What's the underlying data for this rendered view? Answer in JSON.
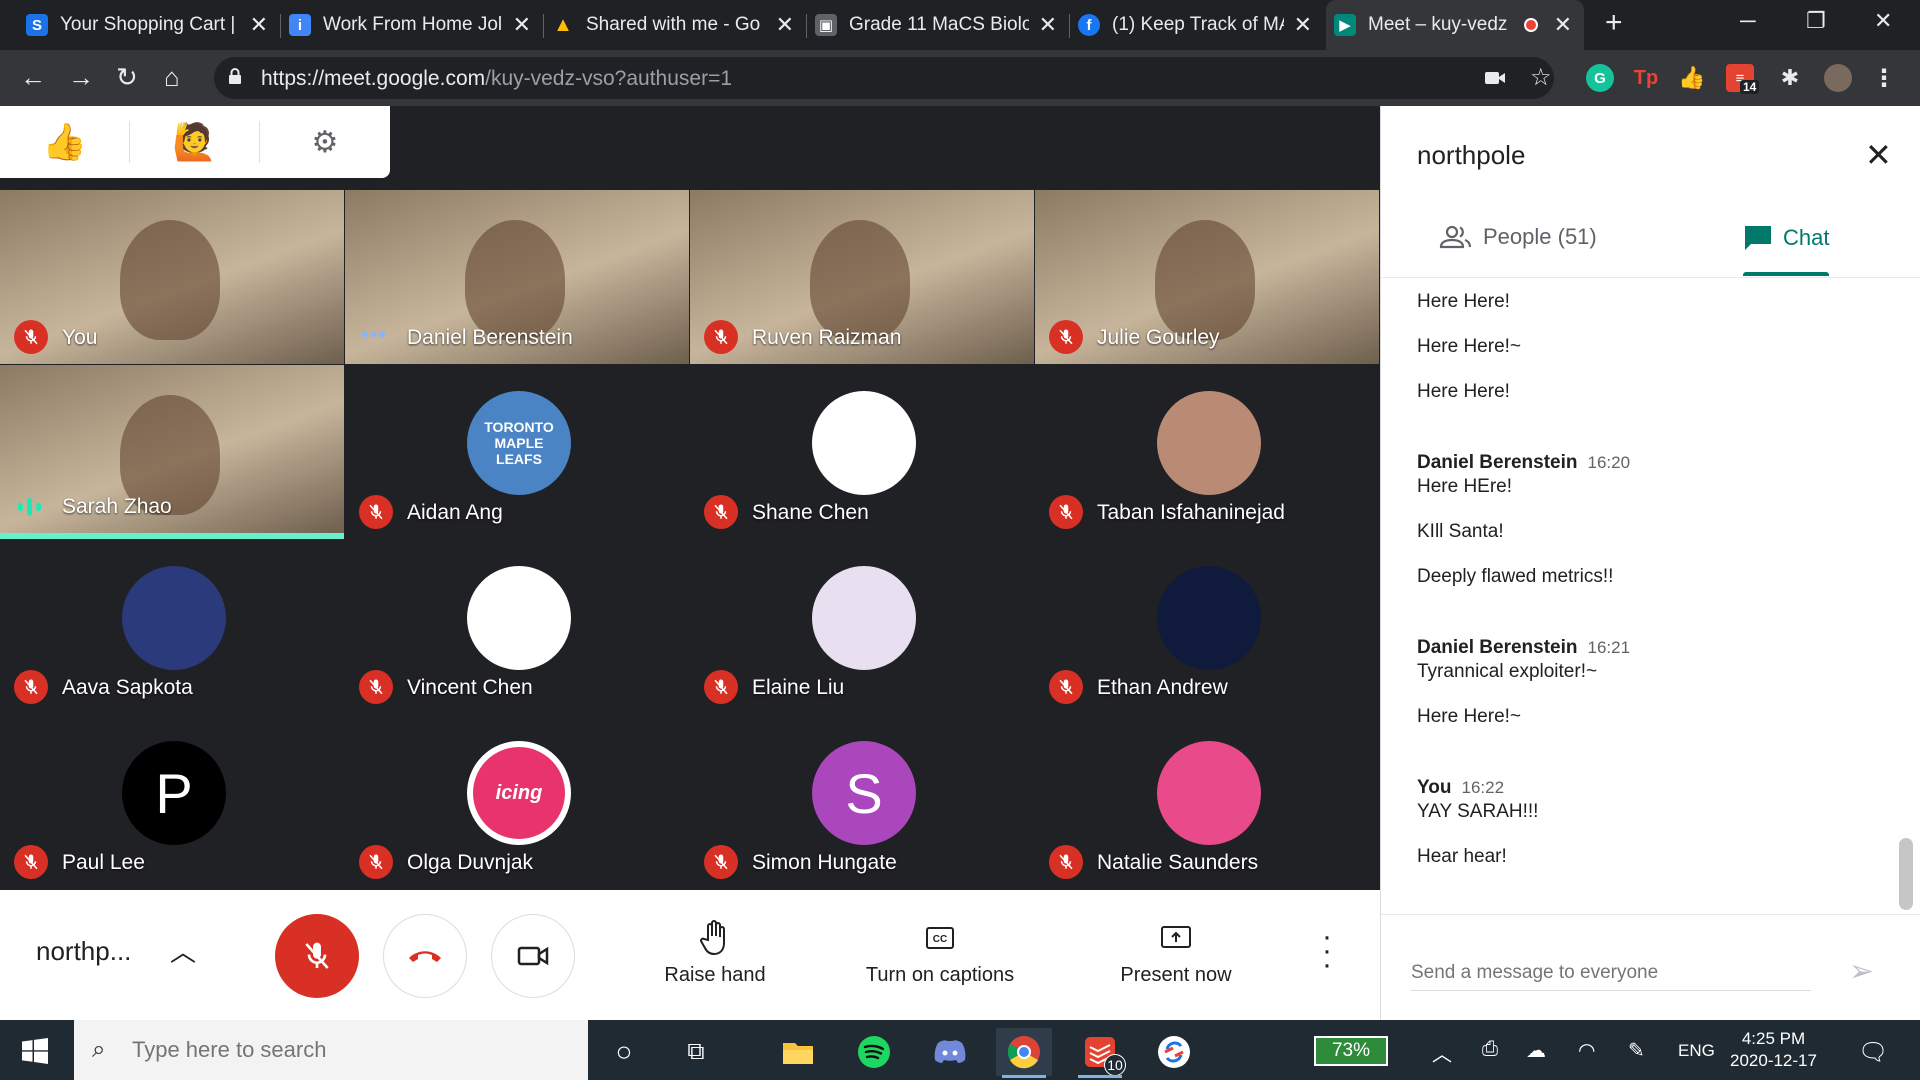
{
  "browser": {
    "tabs": [
      {
        "title": "Your Shopping Cart |",
        "fav_color": "#1a73e8",
        "fav_glyph": "S"
      },
      {
        "title": "Work From Home Jol",
        "fav_color": "#4285f4",
        "fav_glyph": "i"
      },
      {
        "title": "Shared with me - Go",
        "fav_color": "#34a853",
        "fav_glyph": "▲"
      },
      {
        "title": "Grade 11 MaCS Biolo",
        "fav_color": "#5f6368",
        "fav_glyph": "▣"
      },
      {
        "title": "(1) Keep Track of MA",
        "fav_color": "#1877f2",
        "fav_glyph": "f"
      },
      {
        "title": "Meet – kuy-vedz",
        "fav_color": "#00897b",
        "fav_glyph": "▶"
      }
    ],
    "url_host": "https://meet.google.com",
    "url_path": "/kuy-vedz-vso?authuser=1",
    "ext_badge": "14"
  },
  "meet": {
    "participants": [
      {
        "name": "You",
        "kind": "video",
        "status": "muted"
      },
      {
        "name": "Daniel Berenstein",
        "kind": "video",
        "status": "dots"
      },
      {
        "name": "Ruven Raizman",
        "kind": "video",
        "status": "muted"
      },
      {
        "name": "Julie Gourley",
        "kind": "video",
        "status": "muted"
      },
      {
        "name": "Sarah Zhao",
        "kind": "video",
        "status": "speaking"
      },
      {
        "name": "Aidan Ang",
        "kind": "avatar",
        "status": "muted",
        "avatar_color": "#4a84c4",
        "avatar_text": "TORONTO\nMAPLE\nLEAFS"
      },
      {
        "name": "Shane Chen",
        "kind": "avatar",
        "status": "muted",
        "avatar_color": "#ffffff",
        "avatar_text": ""
      },
      {
        "name": "Taban Isfahaninejad",
        "kind": "avatar",
        "status": "muted",
        "avatar_color": "#b98a74",
        "avatar_text": ""
      },
      {
        "name": "Aava Sapkota",
        "kind": "avatar",
        "status": "muted",
        "avatar_color": "#2a3a7a",
        "avatar_text": ""
      },
      {
        "name": "Vincent Chen",
        "kind": "avatar",
        "status": "muted",
        "avatar_color": "#ffffff",
        "avatar_text": ""
      },
      {
        "name": "Elaine Liu",
        "kind": "avatar",
        "status": "muted",
        "avatar_color": "#e8e0f0",
        "avatar_text": ""
      },
      {
        "name": "Ethan Andrew",
        "kind": "avatar",
        "status": "muted",
        "avatar_color": "#0f1a3c",
        "avatar_text": ""
      },
      {
        "name": "Paul Lee",
        "kind": "avatar",
        "status": "muted",
        "avatar_color": "#000000",
        "avatar_text": "P"
      },
      {
        "name": "Olga Duvnjak",
        "kind": "avatar",
        "status": "muted",
        "avatar_color": "#e8336d",
        "avatar_text": "icing"
      },
      {
        "name": "Simon Hungate",
        "kind": "avatar",
        "status": "muted",
        "avatar_color": "#ab47bc",
        "avatar_text": "S"
      },
      {
        "name": "Natalie Saunders",
        "kind": "avatar",
        "status": "muted",
        "avatar_color": "#e84a8a",
        "avatar_text": ""
      }
    ],
    "meeting_name": "northp...",
    "actions": {
      "raise_hand": "Raise hand",
      "captions": "Turn on captions",
      "present": "Present now"
    }
  },
  "panel": {
    "title": "northpole",
    "people_tab": "People (51)",
    "chat_tab": "Chat",
    "messages": [
      {
        "sender": "",
        "time": "",
        "text": "Here Here!"
      },
      {
        "sender": "",
        "time": "",
        "text": "Here Here!~"
      },
      {
        "sender": "",
        "time": "",
        "text": "Here Here!"
      },
      {
        "sender": "Daniel Berenstein",
        "time": "16:20",
        "text": "Here HEre!"
      },
      {
        "sender": "",
        "time": "",
        "text": "KIll Santa!"
      },
      {
        "sender": "",
        "time": "",
        "text": "Deeply flawed metrics!!"
      },
      {
        "sender": "Daniel Berenstein",
        "time": "16:21",
        "text": "Tyrannical exploiter!~"
      },
      {
        "sender": "",
        "time": "",
        "text": "Here Here!~"
      },
      {
        "sender": "You",
        "time": "16:22",
        "text": "YAY SARAH!!!"
      },
      {
        "sender": "",
        "time": "",
        "text": "Hear hear!"
      }
    ],
    "input_placeholder": "Send a message to everyone"
  },
  "taskbar": {
    "search_placeholder": "Type here to search",
    "todoist_badge": "10",
    "battery": "73%",
    "lang": "ENG",
    "time": "4:25 PM",
    "date": "2020-12-17"
  }
}
